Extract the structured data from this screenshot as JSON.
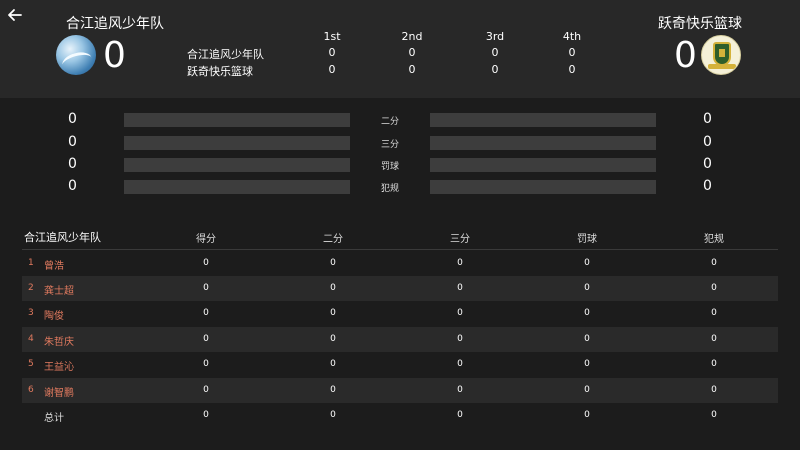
{
  "header": {
    "home_team": "合江追风少年队",
    "away_team": "跃奇快乐篮球",
    "home_score": "0",
    "away_score": "0",
    "home_logo_icon": "wave-logo-icon",
    "away_logo_icon": "shield-crest-logo-icon"
  },
  "quarters": {
    "labels": [
      "1st",
      "2nd",
      "3rd",
      "4th"
    ],
    "rows": [
      {
        "team": "合江追风少年队",
        "scores": [
          "0",
          "0",
          "0",
          "0"
        ]
      },
      {
        "team": "跃奇快乐篮球",
        "scores": [
          "0",
          "0",
          "0",
          "0"
        ]
      }
    ]
  },
  "stats": [
    {
      "label": "二分",
      "home": "0",
      "away": "0",
      "home_fraction": 0,
      "away_fraction": 0
    },
    {
      "label": "三分",
      "home": "0",
      "away": "0",
      "home_fraction": 0,
      "away_fraction": 0
    },
    {
      "label": "罚球",
      "home": "0",
      "away": "0",
      "home_fraction": 0,
      "away_fraction": 0
    },
    {
      "label": "犯规",
      "home": "0",
      "away": "0",
      "home_fraction": 0,
      "away_fraction": 0
    }
  ],
  "player_table": {
    "team": "合江追风少年队",
    "columns": [
      "得分",
      "二分",
      "三分",
      "罚球",
      "犯规"
    ],
    "rows": [
      {
        "no": "1",
        "name": "曾浩",
        "values": [
          "0",
          "0",
          "0",
          "0",
          "0"
        ]
      },
      {
        "no": "2",
        "name": "龚士超",
        "values": [
          "0",
          "0",
          "0",
          "0",
          "0"
        ]
      },
      {
        "no": "3",
        "name": "陶俊",
        "values": [
          "0",
          "0",
          "0",
          "0",
          "0"
        ]
      },
      {
        "no": "4",
        "name": "朱哲庆",
        "values": [
          "0",
          "0",
          "0",
          "0",
          "0"
        ]
      },
      {
        "no": "5",
        "name": "王益沁",
        "values": [
          "0",
          "0",
          "0",
          "0",
          "0"
        ]
      },
      {
        "no": "6",
        "name": "谢智鹏",
        "values": [
          "0",
          "0",
          "0",
          "0",
          "0"
        ]
      }
    ],
    "total": {
      "name": "总计",
      "values": [
        "0",
        "0",
        "0",
        "0",
        "0"
      ]
    }
  },
  "colors": {
    "accent": "#e07a5f",
    "bar_bg": "#3d3d3d",
    "header_bg": "#282828",
    "page_bg": "#1c1c1c"
  }
}
